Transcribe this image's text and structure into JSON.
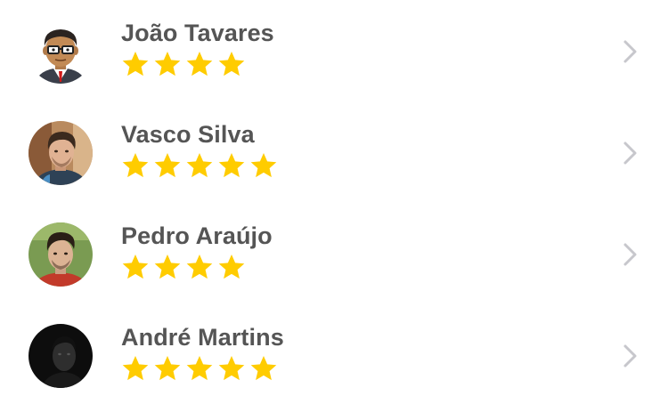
{
  "colors": {
    "name_text": "#555555",
    "star": "#FFCC00",
    "chevron": "#C7C7CC",
    "background": "#FFFFFF"
  },
  "people": [
    {
      "name": "João Tavares",
      "rating": 4,
      "avatar": "cartoon-businessman-avatar"
    },
    {
      "name": "Vasco Silva",
      "rating": 5,
      "avatar": "photo-avatar"
    },
    {
      "name": "Pedro Araújo",
      "rating": 4,
      "avatar": "photo-avatar"
    },
    {
      "name": "André Martins",
      "rating": 5,
      "avatar": "dark-photo-avatar"
    }
  ],
  "icons": {
    "row_action": "chevron-right-icon",
    "rating": "star-icon"
  }
}
